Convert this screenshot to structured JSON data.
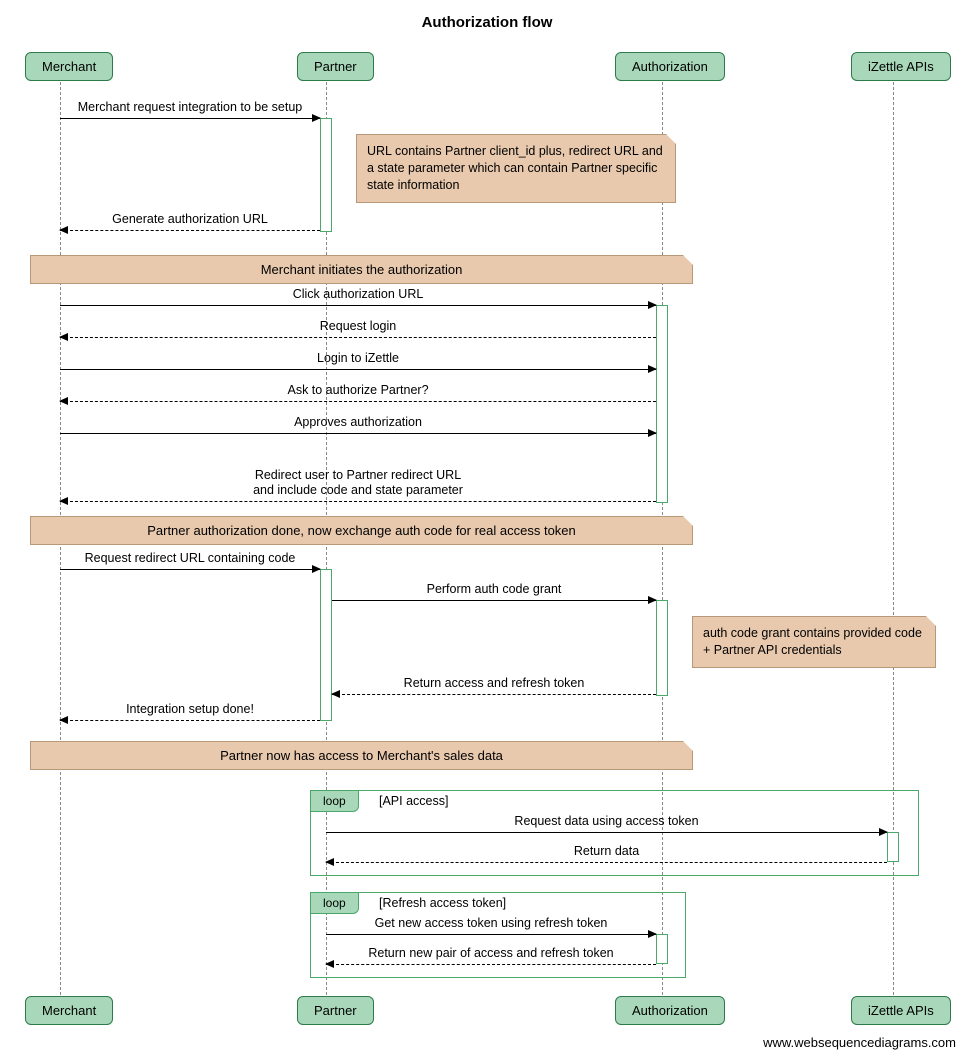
{
  "title": "Authorization flow",
  "actors": {
    "merchant": "Merchant",
    "partner": "Partner",
    "auth": "Authorization",
    "apis": "iZettle APIs"
  },
  "messages": {
    "m1": "Merchant request integration to be setup",
    "m2": "Generate authorization URL",
    "m3": "Click authorization URL",
    "m4": "Request login",
    "m5": "Login to iZettle",
    "m6": "Ask to authorize Partner?",
    "m7": "Approves authorization",
    "m8a": "Redirect user to Partner redirect URL",
    "m8b": "and include code and state parameter",
    "m9": "Request redirect URL containing code",
    "m10": "Perform auth code grant",
    "m11": "Return access and refresh token",
    "m12": "Integration setup done!",
    "m13": "Request data using access token",
    "m14": "Return data",
    "m15": "Get new access token using refresh token",
    "m16": "Return new pair of access and refresh token"
  },
  "notes": {
    "n1": "URL contains Partner client_id plus, redirect URL and a state parameter which can contain Partner specific state information",
    "n2": "auth code grant contains provided code + Partner API credentials"
  },
  "banners": {
    "b1": "Merchant initiates the authorization",
    "b2": "Partner authorization done, now exchange auth code for real access token",
    "b3": "Partner now has access to Merchant's sales data"
  },
  "loops": {
    "l1": {
      "kw": "loop",
      "cond": "[API access]"
    },
    "l2": {
      "kw": "loop",
      "cond": "[Refresh access token]"
    }
  },
  "footer": "www.websequencediagrams.com"
}
